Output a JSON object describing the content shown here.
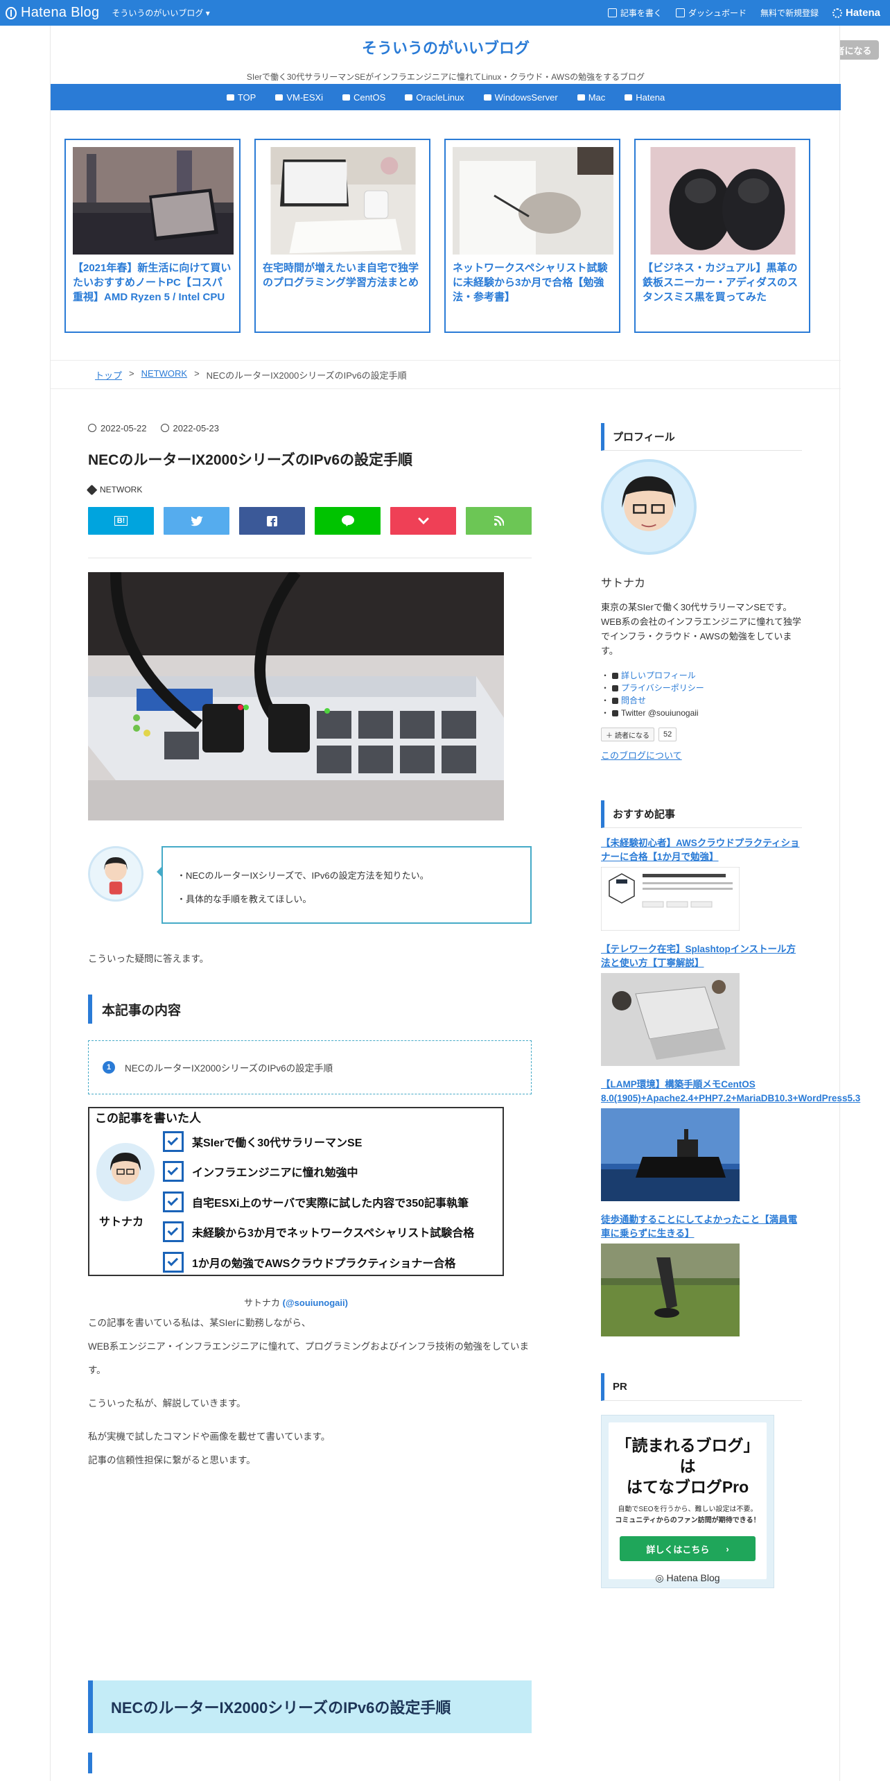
{
  "header": {
    "logo": "Hatena Blog",
    "blog_link": "そういうのがいいブログ",
    "write": "記事を書く",
    "dashboard": "ダッシュボード",
    "signup": "無料で新規登録",
    "hatena": "Hatena"
  },
  "blog": {
    "title": "そういうのがいいブログ",
    "description": "SIerで働く30代サラリーマンSEがインフラエンジニアに憧れてLinux・クラウド・AWSの勉強をするブログ",
    "reader_button": "読者になる"
  },
  "nav": [
    "TOP",
    "VM-ESXi",
    "CentOS",
    "OracleLinux",
    "WindowsServer",
    "Mac",
    "Hatena"
  ],
  "featured": [
    {
      "title": "【2021年春】新生活に向けて買いたいおすすめノートPC【コスパ重視】AMD Ryzen 5 / Intel CPU"
    },
    {
      "title": "在宅時間が増えたいま自宅で独学のプログラミング学習方法まとめ"
    },
    {
      "title": "ネットワークスペシャリスト試験に未経験から3か月で合格【勉強法・参考書】"
    },
    {
      "title": "【ビジネス・カジュアル】黒革の鉄板スニーカー・アディダスのスタンスミス黒を買ってみた"
    }
  ],
  "breadcrumb": {
    "top": "トップ",
    "sep": ">",
    "category": "NETWORK",
    "current": "NECのルーターIX2000シリーズのIPv6の設定手順"
  },
  "article": {
    "date": "2022-05-22",
    "updated": "2022-05-23",
    "title": "NECのルーターIX2000シリーズのIPv6の設定手順",
    "tag": "NETWORK",
    "share": [
      "B!",
      "",
      "",
      "",
      "",
      ""
    ],
    "balloon": [
      "・NECのルーターIXシリーズで、IPv6の設定方法を知りたい。",
      "・具体的な手順を教えてほしい。"
    ],
    "intro": "こういった疑問に答えます。",
    "toc_heading": "本記事の内容",
    "toc_items": [
      "NECのルーターIX2000シリーズのIPv6の設定手順"
    ],
    "author_card": {
      "title": "この記事を書いた人",
      "name": "サトナカ",
      "checks": [
        "某SIerで働く30代サラリーマンSE",
        "インフラエンジニアに憧れ勉強中",
        "自宅ESXi上のサーバで実際に試した内容で350記事執筆",
        "未経験から3か月でネットワークスペシャリスト試験合格",
        "1か月の勉強でAWSクラウドプラクティショナー合格"
      ]
    },
    "caption_name": "サトナカ",
    "caption_handle": "(@souiunogaii)",
    "body": [
      "この記事を書いている私は、某SIerに勤務しながら、",
      "WEB系エンジニア・インフラエンジニアに憧れて、プログラミングおよびインフラ技術の勉強をしています。",
      "こういった私が、解説していきます。",
      "私が実機で試したコマンドや画像を載せて書いています。",
      "記事の信頼性担保に繋がると思います。"
    ],
    "section_heading": "NECのルーターIX2000シリーズのIPv6の設定手順"
  },
  "sidebar": {
    "profile_heading": "プロフィール",
    "profile_name": "サトナカ",
    "profile_desc": [
      "東京の某SIerで働く30代サラリーマンSEです。",
      "WEB系の会社のインフラエンジニアに憧れて独学でインフラ・クラウド・AWSの勉強をしています。"
    ],
    "links": [
      "詳しいプロフィール",
      "プライバシーポリシー",
      "問合せ",
      "Twitter @souiunogaii"
    ],
    "follow": "読者になる",
    "follow_count": "52",
    "about": "このブログについて",
    "rec_heading": "おすすめ記事",
    "recs": [
      {
        "title": "【未経験初心者】AWSクラウドプラクティショナーに合格【1か月で勉強】"
      },
      {
        "title": "【テレワーク在宅】Splashtopインストール方法と使い方【丁寧解説】"
      },
      {
        "title": "【LAMP環境】構築手順メモCentOS 8.0(1905)+Apache2.4+PHP7.2+MariaDB10.3+WordPress5.3"
      },
      {
        "title": "徒歩通勤することにしてよかったこと【満員電車に乗らずに生きる】"
      }
    ],
    "pr_heading": "PR",
    "ad": {
      "title_line1": "「読まれるブログ」は",
      "title_line2": "はてなブログPro",
      "sub1": "自動でSEOを行うから、難しい設定は不要。",
      "sub2": "コミュニティからのファン訪問が期待できる！",
      "button": "詳しくはこちら",
      "logo": "Hatena Blog"
    }
  },
  "colors": {
    "brand": "#2a7bd6",
    "header": "#2980d9",
    "hatebu": "#00a4de",
    "twitter": "#55acee",
    "facebook": "#3b5998",
    "line": "#00c300",
    "pocket": "#ef4056",
    "feedly": "#6cc655"
  }
}
